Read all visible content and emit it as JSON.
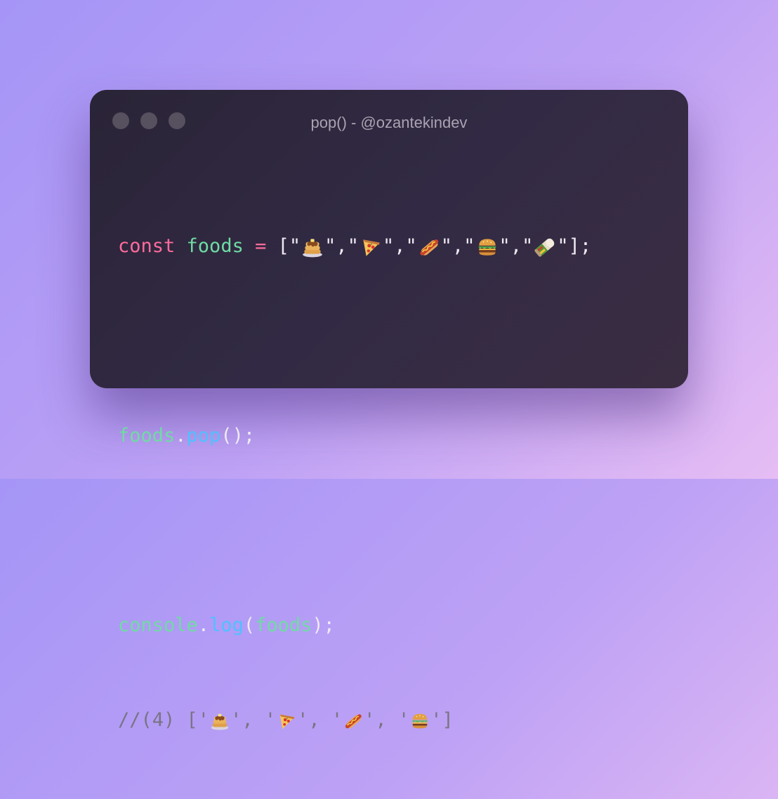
{
  "window": {
    "title": "pop() - @ozantekindev"
  },
  "code": {
    "line1": {
      "keyword": "const",
      "variable": "foods",
      "operator": "=",
      "open": "[",
      "close": "];",
      "items": [
        "pancakes",
        "pizza",
        "hotdog",
        "hamburger",
        "burrito"
      ]
    },
    "line2": {
      "object": "foods",
      "dot": ".",
      "method": "pop",
      "call": "();"
    },
    "line3": {
      "object": "console",
      "dot": ".",
      "method": "log",
      "open_paren": "(",
      "arg": "foods",
      "close": ");"
    },
    "line4": {
      "prefix": "//(4) [",
      "items": [
        "pancakes",
        "pizza",
        "hotdog",
        "hamburger"
      ],
      "close": "]"
    }
  },
  "colors": {
    "keyword": "#ff6b9d",
    "variable": "#6fdba3",
    "function": "#4fc1ff",
    "comment": "#7a7484"
  }
}
